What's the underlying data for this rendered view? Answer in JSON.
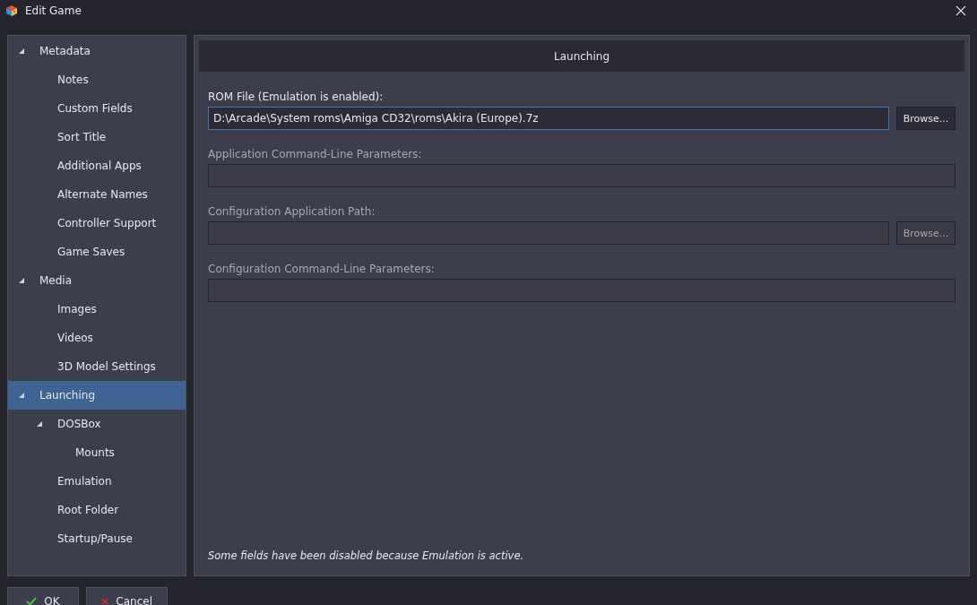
{
  "window": {
    "title": "Edit Game"
  },
  "tree": [
    {
      "label": "Metadata",
      "expanded": true,
      "selected": false,
      "children": [
        {
          "label": "Notes",
          "selected": false
        },
        {
          "label": "Custom Fields",
          "selected": false
        },
        {
          "label": "Sort Title",
          "selected": false
        },
        {
          "label": "Additional Apps",
          "selected": false
        },
        {
          "label": "Alternate Names",
          "selected": false
        },
        {
          "label": "Controller Support",
          "selected": false
        },
        {
          "label": "Game Saves",
          "selected": false
        }
      ]
    },
    {
      "label": "Media",
      "expanded": true,
      "selected": false,
      "children": [
        {
          "label": "Images",
          "selected": false
        },
        {
          "label": "Videos",
          "selected": false
        },
        {
          "label": "3D Model Settings",
          "selected": false
        }
      ]
    },
    {
      "label": "Launching",
      "expanded": true,
      "selected": true,
      "children": [
        {
          "label": "DOSBox",
          "expanded": true,
          "selected": false,
          "children": [
            {
              "label": "Mounts",
              "selected": false
            }
          ]
        },
        {
          "label": "Emulation",
          "selected": false
        },
        {
          "label": "Root Folder",
          "selected": false
        },
        {
          "label": "Startup/Pause",
          "selected": false
        }
      ]
    }
  ],
  "panel": {
    "title": "Launching",
    "fields": [
      {
        "label": "ROM File (Emulation is enabled):",
        "value": "D:\\Arcade\\System roms\\Amiga CD32\\roms\\Akira (Europe).7z",
        "disabled": false,
        "focused": true,
        "browse": "Browse..."
      },
      {
        "label": "Application Command-Line Parameters:",
        "disabled": true,
        "focused": false
      },
      {
        "label": "Configuration Application Path:",
        "disabled": true,
        "focused": false,
        "browse": "Browse..."
      },
      {
        "label": "Configuration Command-Line Parameters:",
        "disabled": true,
        "focused": false
      }
    ],
    "note": "Some fields have been disabled because Emulation is active."
  },
  "buttons": [
    {
      "kind": "ok",
      "label": "OK"
    },
    {
      "kind": "cancel",
      "label": "Cancel"
    }
  ]
}
